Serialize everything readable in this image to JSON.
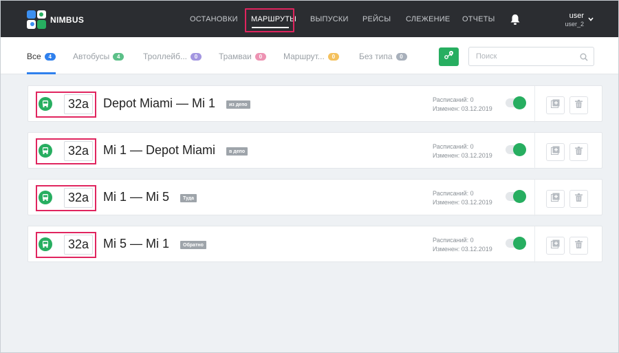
{
  "app": {
    "name": "NIMBUS"
  },
  "nav": {
    "items": [
      {
        "label": "ОСТАНОВКИ",
        "active": false
      },
      {
        "label": "МАРШРУТЫ",
        "active": true
      },
      {
        "label": "ВЫПУСКИ",
        "active": false
      },
      {
        "label": "РЕЙСЫ",
        "active": false
      },
      {
        "label": "СЛЕЖЕНИЕ",
        "active": false
      },
      {
        "label": "ОТЧЕТЫ",
        "active": false
      }
    ],
    "bell_icon": "bell-icon"
  },
  "user": {
    "name": "user",
    "id": "user_2"
  },
  "tabs": [
    {
      "label": "Все",
      "count": "4",
      "color": "#2f80ed",
      "active": true
    },
    {
      "label": "Автобусы",
      "count": "4",
      "color": "#27ae60",
      "active": false
    },
    {
      "label": "Троллейб...",
      "count": "0",
      "color": "#8e7fd6",
      "active": false
    },
    {
      "label": "Трамваи",
      "count": "0",
      "color": "#e87fa3",
      "active": false
    },
    {
      "label": "Маршрут...",
      "count": "0",
      "color": "#f2b13a",
      "active": false
    },
    {
      "label": "Без типа",
      "count": "0",
      "color": "#9aa3b0",
      "active": false
    }
  ],
  "search": {
    "placeholder": "Поиск",
    "value": ""
  },
  "routes": [
    {
      "number": "32a",
      "name": "Depot Miami — Mi 1",
      "tag": "из депо",
      "schedules": "Расписаний: 0",
      "modified": "Изменен: 03.12.2019",
      "enabled": true
    },
    {
      "number": "32a",
      "name": "Mi 1 — Depot Miami",
      "tag": "в депо",
      "schedules": "Расписаний: 0",
      "modified": "Изменен: 03.12.2019",
      "enabled": true
    },
    {
      "number": "32a",
      "name": "Mi 1 — Mi 5",
      "tag": "Туда",
      "schedules": "Расписаний: 0",
      "modified": "Изменен: 03.12.2019",
      "enabled": true
    },
    {
      "number": "32a",
      "name": "Mi 5 — Mi 1",
      "tag": "Обратно",
      "schedules": "Расписаний: 0",
      "modified": "Изменен: 03.12.2019",
      "enabled": true
    }
  ],
  "colors": {
    "accent": "#2f80ed",
    "success": "#27ae60",
    "highlight": "#e0245e",
    "topbar": "#2b2d31"
  }
}
